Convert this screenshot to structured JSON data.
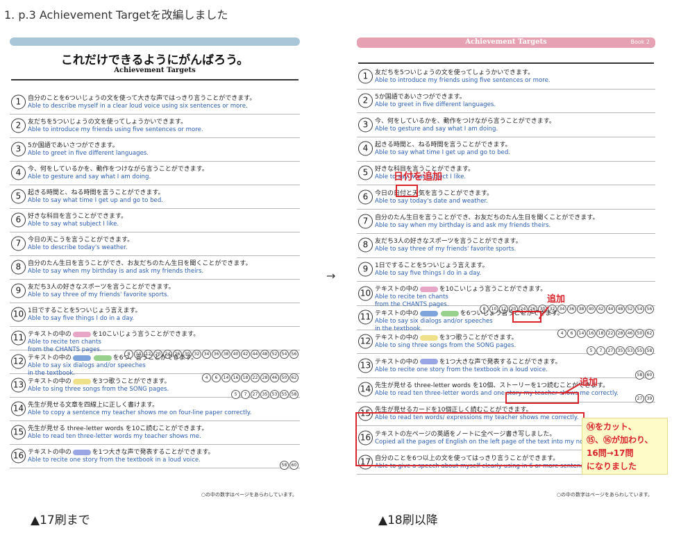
{
  "heading": "1. p.3 Achievement Targetを改編しました",
  "arrow": "→",
  "caption_left": "▲17刷まで",
  "caption_right": "▲18刷以降",
  "left_page": {
    "big_title": "これだけできるようにがんばろう。",
    "subtitle": "Achievement Targets",
    "footnote": "○の中の数字はページをあらわしています。",
    "items": [
      {
        "num": "1",
        "jp": "自分のことを6ついじょうの文を使って大きな声ではっきり言うことができます。",
        "en": "Able to describe myself in a clear loud voice using six sentences or more.",
        "en2": "",
        "pages": []
      },
      {
        "num": "2",
        "jp": "友だちを5ついじょうの文を使ってしょうかいできます。",
        "en": "Able to introduce my friends using five sentences or more.",
        "en2": "",
        "pages": []
      },
      {
        "num": "3",
        "jp": "5か国語であいさつができます。",
        "en": "Able to greet in five different languages.",
        "en2": "",
        "pages": []
      },
      {
        "num": "4",
        "jp": "今、何をしているかを、動作をつけながら言うことができます。",
        "en": "Able to gesture and say what I am doing.",
        "en2": "",
        "pages": []
      },
      {
        "num": "5",
        "jp": "起きる時間と、ねる時間を言うことができます。",
        "en": "Able to say what time I get up and go to bed.",
        "en2": "",
        "pages": []
      },
      {
        "num": "6",
        "jp": "好きな科目を言うことができます。",
        "en": "Able to say what subject I like.",
        "en2": "",
        "pages": []
      },
      {
        "num": "7",
        "jp": "今日の天こうを言うことができます。",
        "en": "Able to describe today's weather.",
        "en2": "",
        "pages": []
      },
      {
        "num": "8",
        "jp": "自分のたん生日を言うことができ、お友だちのたん生日を聞くことができます。",
        "en": "Able to say when my birthday is and ask my friends theirs.",
        "en2": "",
        "pages": []
      },
      {
        "num": "9",
        "jp": "友だち3人の好きなスポーツを言うことができます。",
        "en": "Able to say three of my friends' favorite sports.",
        "en2": "",
        "pages": []
      },
      {
        "num": "10",
        "jp": "1日ですることを5ついじょう言えます。",
        "en": "Able to say five things I do in a day.",
        "en2": "",
        "pages": []
      },
      {
        "num": "11",
        "jp": "テキストの中の",
        "chip": "pink",
        "jp_after": "を10こいじょう言うことができます。",
        "en": "Able to recite ten chants",
        "en2": "from the CHANTS pages.",
        "pages": [
          "8",
          "10",
          "12",
          "20",
          "24",
          "26",
          "30",
          "32",
          "34",
          "36",
          "38",
          "40",
          "42",
          "44",
          "48",
          "52",
          "54",
          "56"
        ]
      },
      {
        "num": "12",
        "jp": "テキストの中の",
        "chip": "blue",
        "chip2": "green",
        "jp_after": "を6つ、言うことができます。",
        "en": "Able to say six dialogs and/or speeches",
        "en2": "in the textbook.",
        "pages": [
          "4",
          "6",
          "14",
          "16",
          "18",
          "22",
          "28",
          "46",
          "50",
          "62"
        ]
      },
      {
        "num": "13",
        "jp": "テキストの中の",
        "chip": "yellow",
        "jp_after": "を3つ歌うことができます。",
        "en": "Able to sing three songs from the SONG pages.",
        "en2": "",
        "pages": [
          "5",
          "7",
          "27",
          "35",
          "53",
          "55",
          "58"
        ]
      },
      {
        "num": "14",
        "jp": "先生が見せる文章を四線上に正しく書けます。",
        "en": "Able to copy a sentence my teacher shows me on four-line paper correctly.",
        "en2": "",
        "pages": []
      },
      {
        "num": "15",
        "jp": "先生が見せる three-letter words を10こ読むことができます。",
        "en": "Able to read ten three-letter words my teacher shows me.",
        "en2": "",
        "pages": []
      },
      {
        "num": "16",
        "jp": "テキストの中の",
        "chip": "purple",
        "jp_after": "を1つ大きな声で発表することができます。",
        "en": "Able to recite one story from the textbook in a loud voice.",
        "en2": "",
        "pages": [
          "58",
          "60"
        ]
      }
    ]
  },
  "right_page": {
    "bar_title": "Achievement Targets",
    "book_label": "Book 2",
    "footnote": "○の中の数字はページをあらわしています。",
    "items": [
      {
        "num": "1",
        "jp": "友だちを5ついじょうの文を使ってしょうかいできます。",
        "en": "Able to introduce my friends using five sentences or more.",
        "en2": "",
        "pages": []
      },
      {
        "num": "2",
        "jp": "5か国語であいさつができます。",
        "en": "Able to greet in five different languages.",
        "en2": "",
        "pages": []
      },
      {
        "num": "3",
        "jp": "今、何をしているかを、動作をつけながら言うことができます。",
        "en": "Able to gesture and say what I am doing.",
        "en2": "",
        "pages": []
      },
      {
        "num": "4",
        "jp": "起きる時間と、ねる時間を言うことができます。",
        "en": "Able to say what time I get up and go to bed.",
        "en2": "",
        "pages": []
      },
      {
        "num": "5",
        "jp": "好きな科目を言うことができます。",
        "en": "Able to say what subject I like.",
        "en2": "",
        "pages": []
      },
      {
        "num": "6",
        "jp": "今日の日付と天気を言うことができます。",
        "en": "Able to say today's date and weather.",
        "en2": "",
        "pages": []
      },
      {
        "num": "7",
        "jp": "自分のたん生日を言うことができ、お友だちのたん生日を聞くことができます。",
        "en": "Able to say when my birthday is and ask my friends theirs.",
        "en2": "",
        "pages": []
      },
      {
        "num": "8",
        "jp": "友だち3人の好きなスポーツを言うことができます。",
        "en": "Able to say three of my friends' favorite sports.",
        "en2": "",
        "pages": []
      },
      {
        "num": "9",
        "jp": "1日ですることを5ついじょう言えます。",
        "en": "Able to say five things I do in a day.",
        "en2": "",
        "pages": []
      },
      {
        "num": "10",
        "jp": "テキストの中の",
        "chip": "pink",
        "jp_after": "を10こいじょう言うことができます。",
        "en": "Able to recite ten chants",
        "en2": "from the CHANTS pages.",
        "pages": [
          "8",
          "10",
          "12",
          "20",
          "24",
          "26",
          "30",
          "32",
          "34",
          "36",
          "38",
          "40",
          "42",
          "44",
          "48",
          "52",
          "54",
          "56"
        ]
      },
      {
        "num": "11",
        "jp": "テキストの中の",
        "chip": "blue",
        "chip2": "green",
        "jp_after": "を6ついじょう言うことができます。",
        "en": "Able to say six dialogs and/or speeches",
        "en2": "in the textbook.",
        "pages": [
          "4",
          "6",
          "14",
          "16",
          "18",
          "22",
          "28",
          "46",
          "50",
          "62"
        ]
      },
      {
        "num": "12",
        "jp": "テキストの中の",
        "chip": "yellow",
        "jp_after": "を3つ歌うことができます。",
        "en": "Able to sing three songs from the SONG pages.",
        "en2": "",
        "pages": [
          "5",
          "7",
          "27",
          "35",
          "53",
          "55",
          "58"
        ]
      },
      {
        "num": "13",
        "jp": "テキストの中の",
        "chip": "purple",
        "jp_after": "を1つ大きな声で発表することができます。",
        "en": "Able to recite one story from the textbook in a loud voice.",
        "en2": "",
        "pages": [
          "58",
          "60"
        ]
      },
      {
        "num": "14",
        "jp": "先生が見せる three-letter words を10個、ストーリーを1つ読むことができます。",
        "en": "Able to read ten three-letter words and one story my teacher shows me correctly.",
        "en2": "",
        "pages": [
          "27",
          "39"
        ]
      },
      {
        "num": "15",
        "jp": "先生が見せるカードを10個正しく読むことができます。",
        "en": "Able to read ten words/ expressions my teacher shows me correctly.",
        "en2": "",
        "pages": []
      },
      {
        "num": "16",
        "jp": "テキストの左ページの英語をノートに全ページ書き写しました。",
        "en": "Copied all the pages of English on the left page of the text into my notebook.",
        "en2": "",
        "pages": []
      },
      {
        "num": "17",
        "jp": "自分のことを6つ以上の文を使ってはっきり言うことができます。",
        "en": "Able to give a speech about myself clearly using in 6 or more sentences.",
        "en2": "",
        "pages": []
      }
    ]
  },
  "annotations": {
    "date_added": "日付を追加",
    "added_1": "追加",
    "added_2": "追加",
    "note": "⑭をカット、\n⑮、⑯が加わり、\n16問→17問\nになりました"
  }
}
